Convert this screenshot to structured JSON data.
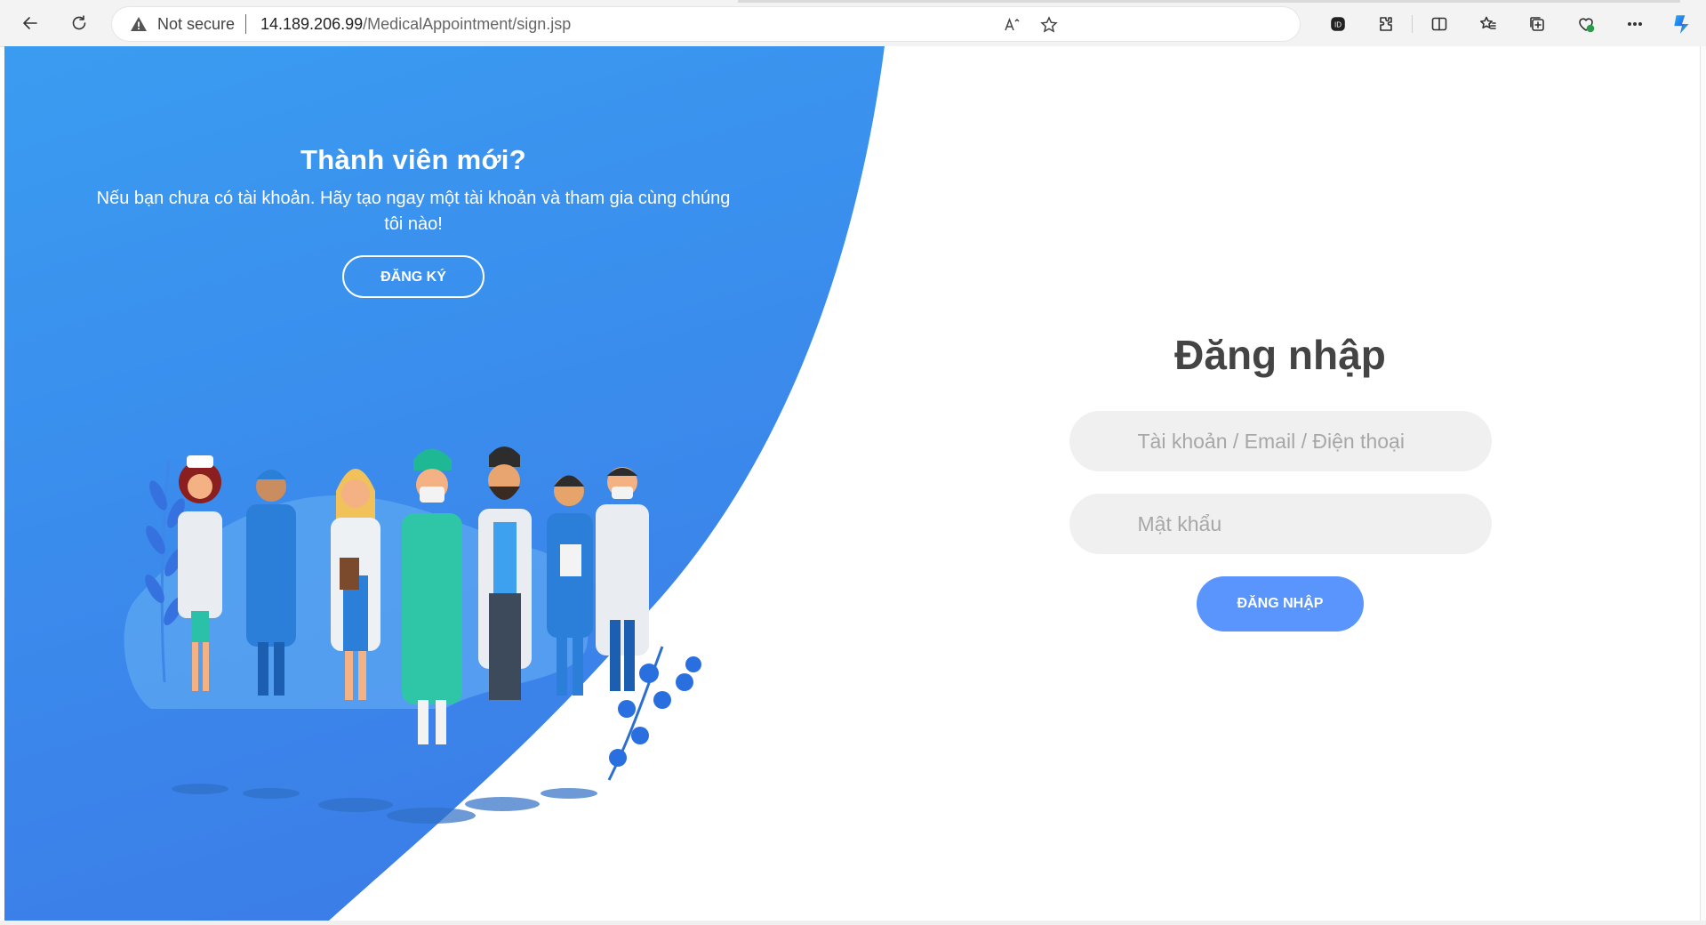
{
  "browser": {
    "security_label": "Not secure",
    "url_host": "14.189.206.99",
    "url_path": "/MedicalAppointment/sign.jsp",
    "read_aloud_icon": "read-aloud-icon",
    "favorite_icon": "star-icon"
  },
  "signup": {
    "title": "Thành viên mới?",
    "text": "Nếu bạn chưa có tài khoản. Hãy tạo ngay một tài khoản và tham gia cùng chúng tôi nào!",
    "button_label": "ĐĂNG KÝ"
  },
  "login": {
    "title": "Đăng nhập",
    "username_placeholder": "Tài khoản / Email / Điện thoại",
    "password_placeholder": "Mật khẩu",
    "button_label": "ĐĂNG NHẬP"
  },
  "colors": {
    "panel_gradient_start": "#3b9cf0",
    "panel_gradient_end": "#3a7fe8",
    "login_button": "#5995fd",
    "title_text": "#444444"
  }
}
